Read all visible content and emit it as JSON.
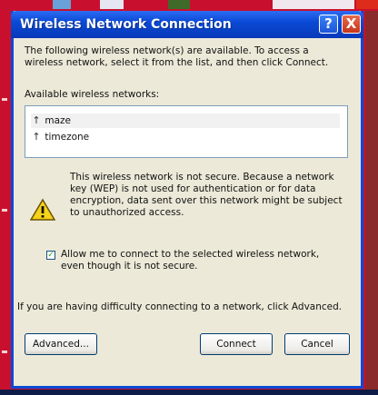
{
  "window": {
    "title": "Wireless Network Connection",
    "help_glyph": "?",
    "close_glyph": "X"
  },
  "description": "The following wireless network(s) are available. To access a wireless network, select it from the list, and then click Connect.",
  "available_label": "Available wireless networks:",
  "networks": [
    {
      "name": "maze",
      "selected": true
    },
    {
      "name": "timezone",
      "selected": false
    }
  ],
  "warning": "This wireless network is not secure. Because a network key (WEP) is not used for authentication or for data encryption, data sent over this network might be subject to unauthorized access.",
  "allow_checkbox": {
    "checked": true,
    "label": "Allow me to connect to the selected wireless network, even though it is not secure."
  },
  "help_text": "If you are having difficulty connecting to a network, click Advanced.",
  "buttons": {
    "advanced": "Advanced...",
    "connect": "Connect",
    "cancel": "Cancel"
  },
  "colors": {
    "titlebar": "#0a4ad6",
    "dialog_bg": "#ece9d8",
    "desktop_bg": "#c8102e"
  }
}
